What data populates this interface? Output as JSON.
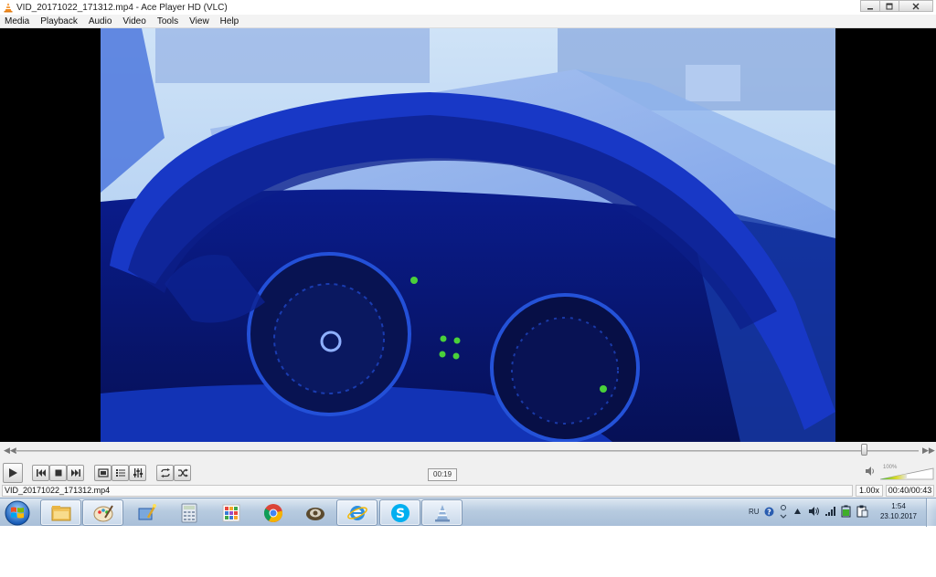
{
  "window": {
    "title": "VID_20171022_171312.mp4 - Ace Player HD (VLC)",
    "icon": "vlc-cone-icon",
    "controls": [
      "minimize-icon",
      "maximize-icon",
      "close-icon"
    ]
  },
  "menu": {
    "items": [
      "Media",
      "Playback",
      "Audio",
      "Video",
      "Tools",
      "View",
      "Help"
    ]
  },
  "player": {
    "progress": 0.94,
    "tooltip_time": "00:19",
    "volume_label": "100%",
    "volume_level": 1.0,
    "buttons": [
      "play-icon",
      "previous-icon",
      "stop-icon",
      "next-icon",
      "fullscreen-icon",
      "playlist-icon",
      "extended-settings-icon",
      "loop-icon",
      "shuffle-icon"
    ]
  },
  "status": {
    "filename": "VID_20171022_171312.mp4",
    "speed": "1.00x",
    "time": "00:40/00:43"
  },
  "taskbar": {
    "apps": [
      "explorer-icon",
      "paint-icon",
      "wizard-icon",
      "calculator-icon",
      "grid-app-icon",
      "chrome-icon",
      "tor-icon",
      "internet-explorer-icon",
      "skype-icon",
      "vlc-cone-icon"
    ],
    "tray": {
      "language": "RU",
      "time": "1:54",
      "date": "23.10.2017"
    }
  },
  "colors": {
    "video_tint": "#2a53e6",
    "taskbar": "#b7cbe0",
    "accent_green": "#4ad03a"
  }
}
